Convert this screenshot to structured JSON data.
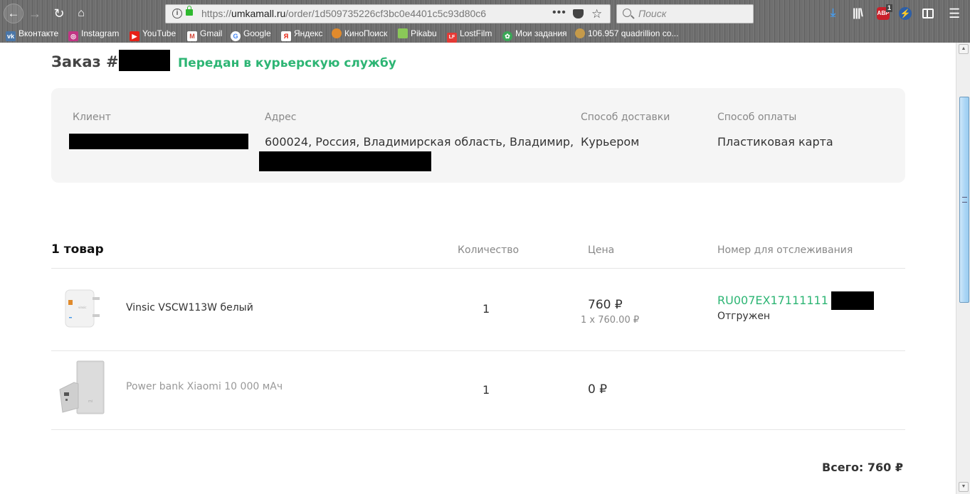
{
  "browser": {
    "url_prefix": "https://",
    "url_domain": "umkamall.ru",
    "url_path": "/order/1d509735226cf3bc0e4401c5c93d80c6",
    "search_placeholder": "Поиск",
    "abp_badge": "1",
    "abp_label": "ABP",
    "bookmarks": [
      {
        "label": "Вконтакте",
        "icon": "vk-icon",
        "glyph": "vk",
        "color": "#4a76a8"
      },
      {
        "label": "Instagram",
        "icon": "instagram-icon",
        "glyph": "◎",
        "color": "#c13584"
      },
      {
        "label": "YouTube",
        "icon": "youtube-icon",
        "glyph": "▶",
        "color": "#e62117"
      },
      {
        "label": "Gmail",
        "icon": "gmail-icon",
        "glyph": "M",
        "color": "#d44638"
      },
      {
        "label": "Google",
        "icon": "google-icon",
        "glyph": "G",
        "color": "#4285f4"
      },
      {
        "label": "Яндекс",
        "icon": "yandex-icon",
        "glyph": "Я",
        "color": "#ffffff"
      },
      {
        "label": "КиноПоиск",
        "icon": "kinopoisk-icon",
        "glyph": "●",
        "color": "#e08a2c"
      },
      {
        "label": "Pikabu",
        "icon": "pikabu-icon",
        "glyph": "●",
        "color": "#8ac858"
      },
      {
        "label": "LostFilm",
        "icon": "lostfilm-icon",
        "glyph": "LF",
        "color": "#e53935"
      },
      {
        "label": "Мои задания",
        "icon": "tasks-icon",
        "glyph": "✿",
        "color": "#3aa757"
      },
      {
        "label": "106.957 quadrillion co...",
        "icon": "cookie-icon",
        "glyph": "●",
        "color": "#c59a4a"
      }
    ]
  },
  "order": {
    "title_prefix": "Заказ #",
    "status": "Передан в курьерскую службу",
    "status_color": "#2db574"
  },
  "info": {
    "client_label": "Клиент",
    "address_label": "Адрес",
    "address_value": "600024, Россия, Владимирская область, Владимир,",
    "delivery_label": "Способ доставки",
    "delivery_value": "Курьером",
    "payment_label": "Способ оплаты",
    "payment_value": "Пластиковая карта"
  },
  "items": {
    "title": "1 товар",
    "headers": {
      "quantity": "Количество",
      "price": "Цена",
      "tracking": "Номер для отслеживания"
    },
    "rows": [
      {
        "name": "Vinsic VSCW113W белый",
        "quantity": "1",
        "price": "760 ₽",
        "unit_price": "1 x 760.00 ₽",
        "tracking": "RU007EX17111111",
        "tracking_status": "Отгружен"
      },
      {
        "name": "Power bank Xiaomi 10 000 мАч",
        "quantity": "1",
        "price": "0 ₽"
      }
    ]
  },
  "total": "Всего: 760 ₽"
}
